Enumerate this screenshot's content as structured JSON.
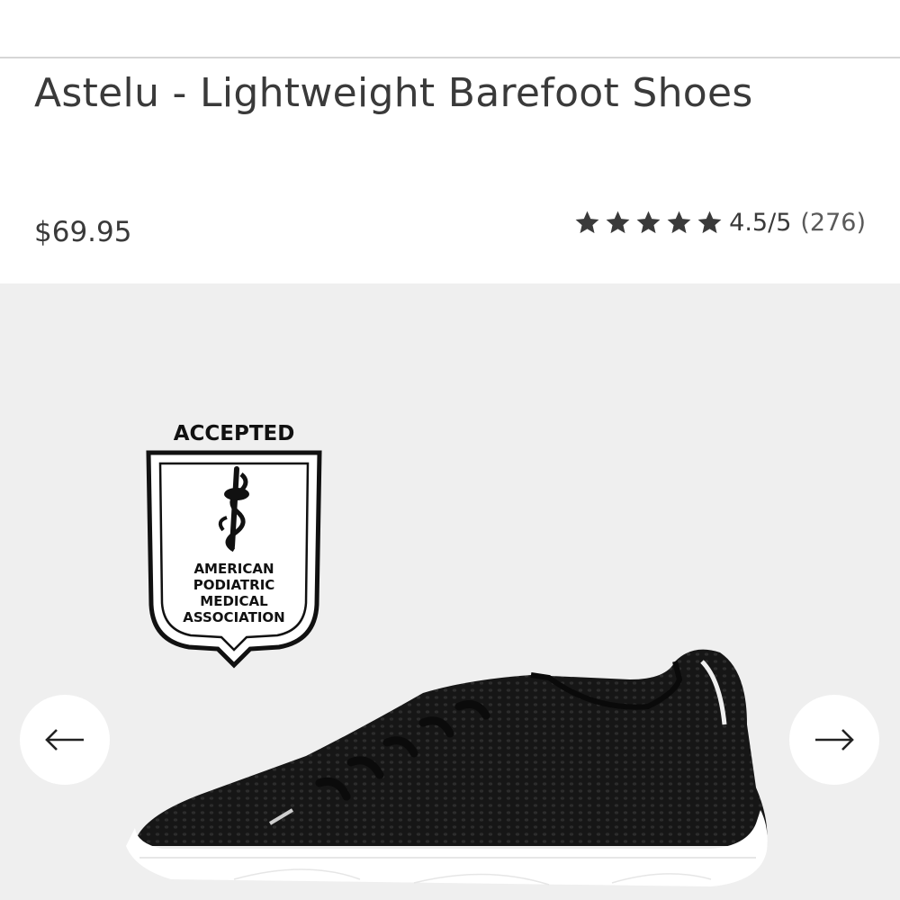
{
  "product": {
    "title": "Astelu - Lightweight Barefoot Shoes",
    "price": "$69.95",
    "rating": {
      "score": 4.5,
      "label": "4.5/5",
      "count": "(276)",
      "stars": 5
    }
  },
  "badge": {
    "top_text": "ACCEPTED",
    "lines": [
      "AMERICAN",
      "PODIATRIC",
      "MEDICAL",
      "ASSOCIATION"
    ]
  },
  "gallery": {
    "prev_icon": "arrow-left-icon",
    "next_icon": "arrow-right-icon"
  },
  "colors": {
    "text": "#3a3a3a",
    "gallery_bg": "#efefef",
    "shoe": "#141414",
    "sole": "#ffffff"
  }
}
